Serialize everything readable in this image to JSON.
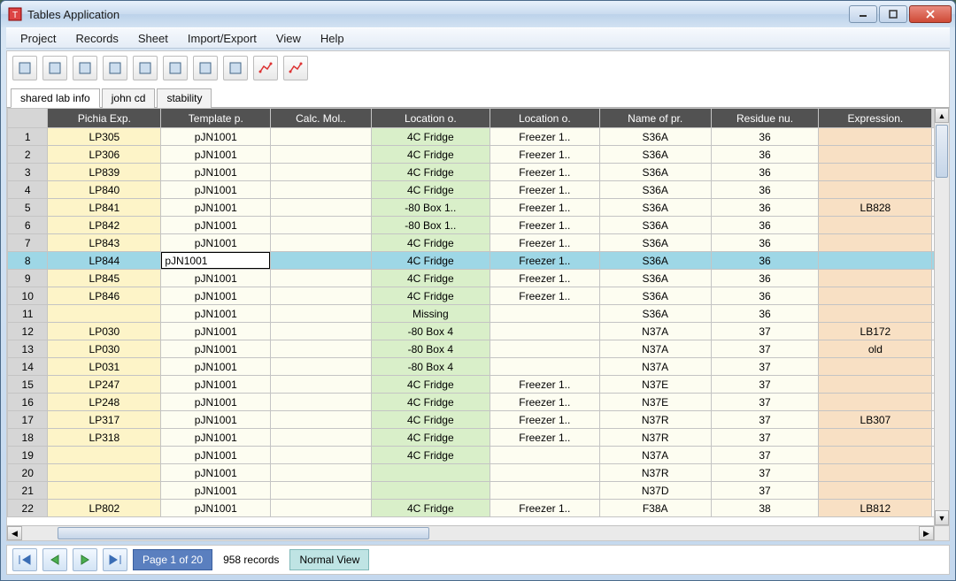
{
  "window": {
    "title": "Tables Application"
  },
  "menu": [
    "Project",
    "Records",
    "Sheet",
    "Import/Export",
    "View",
    "Help"
  ],
  "toolbar_icons": [
    "new-sheet",
    "add-row",
    "copy-row",
    "import",
    "export",
    "save",
    "print",
    "delete-row",
    "plot-line",
    "plot-scatter"
  ],
  "tabs": [
    {
      "label": "shared lab info",
      "active": true
    },
    {
      "label": "john cd",
      "active": false
    },
    {
      "label": "stability",
      "active": false
    }
  ],
  "columns": [
    "Pichia Exp.",
    "Template p.",
    "Calc. Mol..",
    "Location o.",
    "Location o.",
    "Name of pr.",
    "Residue nu.",
    "Expression."
  ],
  "selected_row_index": 7,
  "editing_cell": {
    "row": 7,
    "col": 1,
    "value": "pJN1001"
  },
  "rows": [
    {
      "n": 1,
      "cells": [
        "LP305",
        "pJN1001",
        "",
        "4C Fridge",
        "Freezer 1..",
        "S36A",
        "36",
        ""
      ]
    },
    {
      "n": 2,
      "cells": [
        "LP306",
        "pJN1001",
        "",
        "4C Fridge",
        "Freezer 1..",
        "S36A",
        "36",
        ""
      ]
    },
    {
      "n": 3,
      "cells": [
        "LP839",
        "pJN1001",
        "",
        "4C Fridge",
        "Freezer 1..",
        "S36A",
        "36",
        ""
      ]
    },
    {
      "n": 4,
      "cells": [
        "LP840",
        "pJN1001",
        "",
        "4C Fridge",
        "Freezer 1..",
        "S36A",
        "36",
        ""
      ]
    },
    {
      "n": 5,
      "cells": [
        "LP841",
        "pJN1001",
        "",
        "-80 Box 1..",
        "Freezer 1..",
        "S36A",
        "36",
        "LB828"
      ]
    },
    {
      "n": 6,
      "cells": [
        "LP842",
        "pJN1001",
        "",
        "-80 Box 1..",
        "Freezer 1..",
        "S36A",
        "36",
        ""
      ]
    },
    {
      "n": 7,
      "cells": [
        "LP843",
        "pJN1001",
        "",
        "4C Fridge",
        "Freezer 1..",
        "S36A",
        "36",
        ""
      ]
    },
    {
      "n": 8,
      "cells": [
        "LP844",
        "pJN1001",
        "",
        "4C Fridge",
        "Freezer 1..",
        "S36A",
        "36",
        ""
      ]
    },
    {
      "n": 9,
      "cells": [
        "LP845",
        "pJN1001",
        "",
        "4C Fridge",
        "Freezer 1..",
        "S36A",
        "36",
        ""
      ]
    },
    {
      "n": 10,
      "cells": [
        "LP846",
        "pJN1001",
        "",
        "4C Fridge",
        "Freezer 1..",
        "S36A",
        "36",
        ""
      ]
    },
    {
      "n": 11,
      "cells": [
        "",
        "pJN1001",
        "",
        "Missing",
        "",
        "S36A",
        "36",
        ""
      ]
    },
    {
      "n": 12,
      "cells": [
        "LP030",
        "pJN1001",
        "",
        "-80 Box 4",
        "",
        "N37A",
        "37",
        "LB172"
      ]
    },
    {
      "n": 13,
      "cells": [
        "LP030",
        "pJN1001",
        "",
        "-80 Box 4",
        "",
        "N37A",
        "37",
        "old"
      ]
    },
    {
      "n": 14,
      "cells": [
        "LP031",
        "pJN1001",
        "",
        "-80 Box 4",
        "",
        "N37A",
        "37",
        ""
      ]
    },
    {
      "n": 15,
      "cells": [
        "LP247",
        "pJN1001",
        "",
        "4C Fridge",
        "Freezer 1..",
        "N37E",
        "37",
        ""
      ]
    },
    {
      "n": 16,
      "cells": [
        "LP248",
        "pJN1001",
        "",
        "4C Fridge",
        "Freezer 1..",
        "N37E",
        "37",
        ""
      ]
    },
    {
      "n": 17,
      "cells": [
        "LP317",
        "pJN1001",
        "",
        "4C Fridge",
        "Freezer 1..",
        "N37R",
        "37",
        "LB307"
      ]
    },
    {
      "n": 18,
      "cells": [
        "LP318",
        "pJN1001",
        "",
        "4C Fridge",
        "Freezer 1..",
        "N37R",
        "37",
        ""
      ]
    },
    {
      "n": 19,
      "cells": [
        "",
        "pJN1001",
        "",
        "4C Fridge",
        "",
        "N37A",
        "37",
        ""
      ]
    },
    {
      "n": 20,
      "cells": [
        "",
        "pJN1001",
        "",
        "",
        "",
        "N37R",
        "37",
        ""
      ]
    },
    {
      "n": 21,
      "cells": [
        "",
        "pJN1001",
        "",
        "",
        "",
        "N37D",
        "37",
        ""
      ]
    },
    {
      "n": 22,
      "cells": [
        "LP802",
        "pJN1001",
        "",
        "4C Fridge",
        "Freezer 1..",
        "F38A",
        "38",
        "LB812"
      ]
    }
  ],
  "footer": {
    "page_label": "Page 1 of 20",
    "record_count": "958 records",
    "view_mode": "Normal View"
  }
}
